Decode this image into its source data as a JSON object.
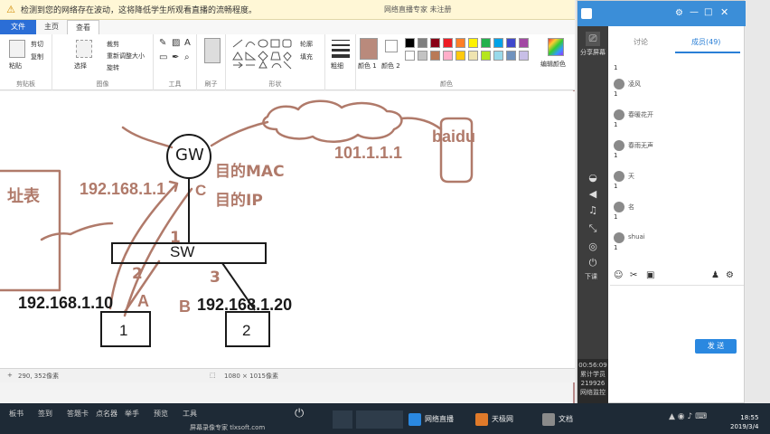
{
  "paint": {
    "notice": "检测到您的网络存在波动，这将降低学生所观看直播的流畅程度。",
    "window_title": "网络直播专家 未注册",
    "tabs": [
      "文件",
      "主页",
      "查看"
    ],
    "ribbon": {
      "clipboard": {
        "paste": "粘贴",
        "cut": "剪切",
        "copy": "复制",
        "label": "剪贴板"
      },
      "image": {
        "select": "选择",
        "crop": "裁剪",
        "resize": "重新调整大小",
        "rotate": "旋转",
        "label": "图像"
      },
      "tools": {
        "label": "工具"
      },
      "brushes": {
        "label": "刷子"
      },
      "shapes": {
        "outline": "轮廓",
        "fill": "填充",
        "label": "形状"
      },
      "size": {
        "label": "粗细"
      },
      "colors": {
        "color1": "颜色 1",
        "color2": "颜色 2",
        "edit": "编辑颜色",
        "label": "颜色"
      },
      "swatch_colors": [
        "#000000",
        "#7f7f7f",
        "#880015",
        "#ed1c24",
        "#ff7f27",
        "#fff200",
        "#22b14c",
        "#00a2e8",
        "#3f48cc",
        "#a349a4",
        "#ffffff",
        "#c3c3c3",
        "#b97a57",
        "#ffaec9",
        "#ffc90e",
        "#efe4b0",
        "#b5e61d",
        "#99d9ea",
        "#7092be",
        "#c8bfe7"
      ]
    },
    "status": {
      "cursor": "290, 352像素",
      "size": "1080 × 1015像素"
    }
  },
  "drawing": {
    "gw": "GW",
    "cloud_ip": "101.1.1.1",
    "baidu": "baidu",
    "dest_mac": "目的MAC",
    "dest_ip": "目的IP",
    "left_ip": "192.168.1.1",
    "left_ip_suffix": "C",
    "addr_table": "址表",
    "sw": "SW",
    "port1": "1",
    "port2": "2",
    "port3": "3",
    "host_a_ip": "192.168.1.10",
    "host_a_letter": "A",
    "host_b_letter": "B",
    "host_b_ip": "192.168.1.20",
    "host1": "1",
    "host2": "2",
    "colors": {
      "pen": "#b07a6a",
      "black": "#1a1a1a"
    }
  },
  "chat": {
    "top_label": "分享屏幕",
    "tabs": [
      "讨论",
      "成员(49)"
    ],
    "members": [
      {
        "name": "凌风",
        "num": "1"
      },
      {
        "name": "春暖花开",
        "num": "1"
      },
      {
        "name": "春雨无声",
        "num": "1"
      },
      {
        "name": "天",
        "num": "1"
      },
      {
        "name": "名",
        "num": "1"
      },
      {
        "name": "shuai",
        "num": "1"
      }
    ],
    "first_num": "1",
    "send": "发 送",
    "side_label": "下课",
    "clock": [
      "00:56:09",
      "累计学员",
      "219926",
      "网络监控"
    ]
  },
  "taskbar": {
    "menu": [
      "板书",
      "签到",
      "答题卡",
      "点名器",
      "举手",
      "预览",
      "工具"
    ],
    "brand": "屏幕录像专家 tlxsoft.com",
    "items": [
      "网络直播",
      "天极网",
      "文档"
    ],
    "time": "18:55",
    "date": "2019/3/4"
  }
}
